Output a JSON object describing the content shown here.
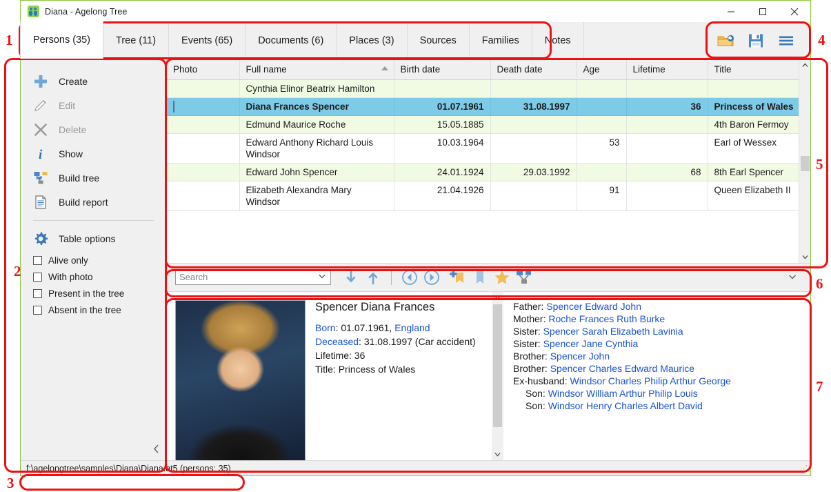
{
  "window": {
    "title": "Diana - Agelong Tree",
    "app_icon": "people-icon",
    "minimize": "minimize-icon",
    "maximize": "maximize-icon",
    "close": "close-icon"
  },
  "tabs": [
    {
      "label": "Persons (35)",
      "active": true
    },
    {
      "label": "Tree (11)",
      "active": false
    },
    {
      "label": "Events (65)",
      "active": false
    },
    {
      "label": "Documents (6)",
      "active": false
    },
    {
      "label": "Places (3)",
      "active": false
    },
    {
      "label": "Sources",
      "active": false
    },
    {
      "label": "Families",
      "active": false
    },
    {
      "label": "Notes",
      "active": false
    }
  ],
  "toolbar_right": [
    {
      "name": "open-folder-icon"
    },
    {
      "name": "save-icon"
    },
    {
      "name": "menu-icon"
    }
  ],
  "sidebar": {
    "actions": [
      {
        "label": "Create",
        "icon": "plus-icon",
        "enabled": true
      },
      {
        "label": "Edit",
        "icon": "pencil-icon",
        "enabled": false
      },
      {
        "label": "Delete",
        "icon": "cross-icon",
        "enabled": false
      },
      {
        "label": "Show",
        "icon": "info-icon",
        "enabled": true
      },
      {
        "label": "Build tree",
        "icon": "tree-icon",
        "enabled": true
      },
      {
        "label": "Build report",
        "icon": "document-icon",
        "enabled": true
      }
    ],
    "options_label": "Table options",
    "options_icon": "gear-icon",
    "checkboxes": [
      {
        "label": "Alive only",
        "checked": false
      },
      {
        "label": "With photo",
        "checked": false
      },
      {
        "label": "Present in the tree",
        "checked": false
      },
      {
        "label": "Absent in the tree",
        "checked": false
      }
    ],
    "collapse_icon": "chevron-left-icon"
  },
  "table": {
    "columns": [
      "Photo",
      "Full name",
      "Birth date",
      "Death date",
      "Age",
      "Lifetime",
      "Title"
    ],
    "sorted_column": "Full name",
    "sort_direction": "asc",
    "rows": [
      {
        "photo": "",
        "full_name": "Cynthia Elinor Beatrix Hamilton",
        "birth_date": "",
        "death_date": "",
        "age": "",
        "lifetime": "",
        "title": "",
        "selected": false,
        "striped": true
      },
      {
        "photo": "diana-portrait",
        "full_name": "Diana Frances Spencer",
        "birth_date": "01.07.1961",
        "death_date": "31.08.1997",
        "age": "",
        "lifetime": "36",
        "title": "Princess of Wales",
        "selected": true,
        "striped": false
      },
      {
        "photo": "",
        "full_name": "Edmund Maurice Roche",
        "birth_date": "15.05.1885",
        "death_date": "",
        "age": "",
        "lifetime": "",
        "title": "4th Baron Fermoy",
        "selected": false,
        "striped": true
      },
      {
        "photo": "",
        "full_name": "Edward Anthony Richard Louis Windsor",
        "birth_date": "10.03.1964",
        "death_date": "",
        "age": "53",
        "lifetime": "",
        "title": "Earl of Wessex",
        "selected": false,
        "striped": false
      },
      {
        "photo": "",
        "full_name": "Edward John Spencer",
        "birth_date": "24.01.1924",
        "death_date": "29.03.1992",
        "age": "",
        "lifetime": "68",
        "title": "8th Earl Spencer",
        "selected": false,
        "striped": true
      },
      {
        "photo": "",
        "full_name": "Elizabeth Alexandra Mary Windsor",
        "birth_date": "21.04.1926",
        "death_date": "",
        "age": "91",
        "lifetime": "",
        "title": "Queen Elizabeth II",
        "selected": false,
        "striped": false
      }
    ]
  },
  "search": {
    "placeholder": "Search",
    "value": "",
    "dropdown_icon": "chevron-down-icon",
    "buttons": [
      {
        "name": "find-next-icon"
      },
      {
        "name": "find-previous-icon"
      },
      {
        "name": "navigate-back-icon"
      },
      {
        "name": "navigate-forward-icon"
      },
      {
        "name": "add-bookmark-icon"
      },
      {
        "name": "bookmark-icon"
      },
      {
        "name": "favorite-star-icon"
      },
      {
        "name": "build-tree-icon"
      }
    ],
    "expand_icon": "chevron-down-icon"
  },
  "detail": {
    "name": "Spencer Diana Frances",
    "photo": "diana-portrait-large",
    "facts": [
      {
        "label": "Born",
        "label_link": true,
        "value": ": 01.07.1961, ",
        "value_link": "England"
      },
      {
        "label": "Deceased",
        "label_link": true,
        "value": ": 31.08.1997 (Car accident)",
        "value_link": ""
      },
      {
        "label": "Lifetime",
        "label_link": false,
        "value": ": 36",
        "value_link": ""
      },
      {
        "label": "Title",
        "label_link": false,
        "value": ": Princess of Wales",
        "value_link": ""
      }
    ],
    "relations": [
      {
        "role": "Father:",
        "name": "Spencer Edward John",
        "indent": false
      },
      {
        "role": "Mother:",
        "name": "Roche Frances Ruth Burke",
        "indent": false
      },
      {
        "role": "Sister:",
        "name": "Spencer Sarah Elizabeth Lavinia",
        "indent": false
      },
      {
        "role": "Sister:",
        "name": "Spencer Jane Cynthia",
        "indent": false
      },
      {
        "role": "Brother:",
        "name": "Spencer John",
        "indent": false
      },
      {
        "role": "Brother:",
        "name": "Spencer Charles Edward Maurice",
        "indent": false
      },
      {
        "role": "Ex-husband:",
        "name": "Windsor Charles Philip Arthur George",
        "indent": false
      },
      {
        "role": "Son:",
        "name": "Windsor William Arthur Philip Louis",
        "indent": true
      },
      {
        "role": "Son:",
        "name": "Windsor Henry Charles Albert David",
        "indent": true
      }
    ]
  },
  "statusbar": {
    "path": "f:\\agelongtree\\samples\\Diana\\Diana.at5 (persons: 35)",
    "grip": "resize-grip-icon"
  },
  "annotations": [
    {
      "number": "1"
    },
    {
      "number": "2"
    },
    {
      "number": "3"
    },
    {
      "number": "4"
    },
    {
      "number": "5"
    },
    {
      "number": "6"
    },
    {
      "number": "7"
    }
  ],
  "colors": {
    "selection": "#7ecbe8",
    "stripe": "#f1fae3",
    "link": "#1a53d0",
    "accent_border": "#8cc63e",
    "annotation": "#ee1111"
  }
}
